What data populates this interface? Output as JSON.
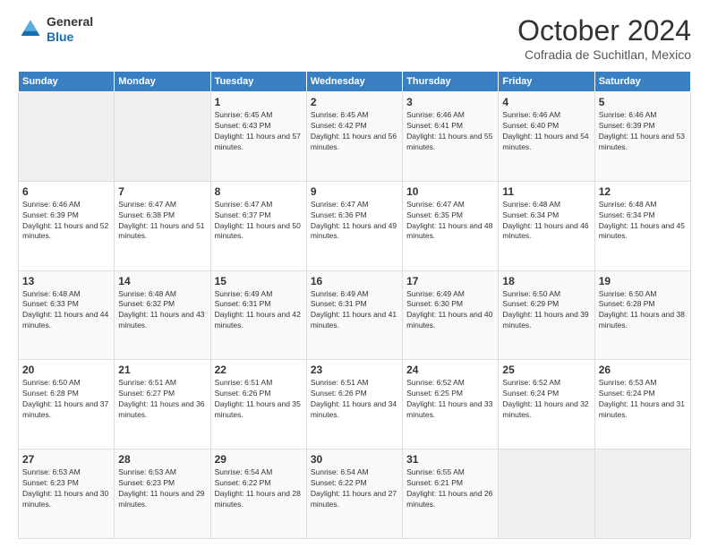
{
  "logo": {
    "general": "General",
    "blue": "Blue"
  },
  "header": {
    "month": "October 2024",
    "location": "Cofradia de Suchitlan, Mexico"
  },
  "weekdays": [
    "Sunday",
    "Monday",
    "Tuesday",
    "Wednesday",
    "Thursday",
    "Friday",
    "Saturday"
  ],
  "weeks": [
    [
      {
        "day": "",
        "sunrise": "",
        "sunset": "",
        "daylight": ""
      },
      {
        "day": "",
        "sunrise": "",
        "sunset": "",
        "daylight": ""
      },
      {
        "day": "1",
        "sunrise": "Sunrise: 6:45 AM",
        "sunset": "Sunset: 6:43 PM",
        "daylight": "Daylight: 11 hours and 57 minutes."
      },
      {
        "day": "2",
        "sunrise": "Sunrise: 6:45 AM",
        "sunset": "Sunset: 6:42 PM",
        "daylight": "Daylight: 11 hours and 56 minutes."
      },
      {
        "day": "3",
        "sunrise": "Sunrise: 6:46 AM",
        "sunset": "Sunset: 6:41 PM",
        "daylight": "Daylight: 11 hours and 55 minutes."
      },
      {
        "day": "4",
        "sunrise": "Sunrise: 6:46 AM",
        "sunset": "Sunset: 6:40 PM",
        "daylight": "Daylight: 11 hours and 54 minutes."
      },
      {
        "day": "5",
        "sunrise": "Sunrise: 6:46 AM",
        "sunset": "Sunset: 6:39 PM",
        "daylight": "Daylight: 11 hours and 53 minutes."
      }
    ],
    [
      {
        "day": "6",
        "sunrise": "Sunrise: 6:46 AM",
        "sunset": "Sunset: 6:39 PM",
        "daylight": "Daylight: 11 hours and 52 minutes."
      },
      {
        "day": "7",
        "sunrise": "Sunrise: 6:47 AM",
        "sunset": "Sunset: 6:38 PM",
        "daylight": "Daylight: 11 hours and 51 minutes."
      },
      {
        "day": "8",
        "sunrise": "Sunrise: 6:47 AM",
        "sunset": "Sunset: 6:37 PM",
        "daylight": "Daylight: 11 hours and 50 minutes."
      },
      {
        "day": "9",
        "sunrise": "Sunrise: 6:47 AM",
        "sunset": "Sunset: 6:36 PM",
        "daylight": "Daylight: 11 hours and 49 minutes."
      },
      {
        "day": "10",
        "sunrise": "Sunrise: 6:47 AM",
        "sunset": "Sunset: 6:35 PM",
        "daylight": "Daylight: 11 hours and 48 minutes."
      },
      {
        "day": "11",
        "sunrise": "Sunrise: 6:48 AM",
        "sunset": "Sunset: 6:34 PM",
        "daylight": "Daylight: 11 hours and 46 minutes."
      },
      {
        "day": "12",
        "sunrise": "Sunrise: 6:48 AM",
        "sunset": "Sunset: 6:34 PM",
        "daylight": "Daylight: 11 hours and 45 minutes."
      }
    ],
    [
      {
        "day": "13",
        "sunrise": "Sunrise: 6:48 AM",
        "sunset": "Sunset: 6:33 PM",
        "daylight": "Daylight: 11 hours and 44 minutes."
      },
      {
        "day": "14",
        "sunrise": "Sunrise: 6:48 AM",
        "sunset": "Sunset: 6:32 PM",
        "daylight": "Daylight: 11 hours and 43 minutes."
      },
      {
        "day": "15",
        "sunrise": "Sunrise: 6:49 AM",
        "sunset": "Sunset: 6:31 PM",
        "daylight": "Daylight: 11 hours and 42 minutes."
      },
      {
        "day": "16",
        "sunrise": "Sunrise: 6:49 AM",
        "sunset": "Sunset: 6:31 PM",
        "daylight": "Daylight: 11 hours and 41 minutes."
      },
      {
        "day": "17",
        "sunrise": "Sunrise: 6:49 AM",
        "sunset": "Sunset: 6:30 PM",
        "daylight": "Daylight: 11 hours and 40 minutes."
      },
      {
        "day": "18",
        "sunrise": "Sunrise: 6:50 AM",
        "sunset": "Sunset: 6:29 PM",
        "daylight": "Daylight: 11 hours and 39 minutes."
      },
      {
        "day": "19",
        "sunrise": "Sunrise: 6:50 AM",
        "sunset": "Sunset: 6:28 PM",
        "daylight": "Daylight: 11 hours and 38 minutes."
      }
    ],
    [
      {
        "day": "20",
        "sunrise": "Sunrise: 6:50 AM",
        "sunset": "Sunset: 6:28 PM",
        "daylight": "Daylight: 11 hours and 37 minutes."
      },
      {
        "day": "21",
        "sunrise": "Sunrise: 6:51 AM",
        "sunset": "Sunset: 6:27 PM",
        "daylight": "Daylight: 11 hours and 36 minutes."
      },
      {
        "day": "22",
        "sunrise": "Sunrise: 6:51 AM",
        "sunset": "Sunset: 6:26 PM",
        "daylight": "Daylight: 11 hours and 35 minutes."
      },
      {
        "day": "23",
        "sunrise": "Sunrise: 6:51 AM",
        "sunset": "Sunset: 6:26 PM",
        "daylight": "Daylight: 11 hours and 34 minutes."
      },
      {
        "day": "24",
        "sunrise": "Sunrise: 6:52 AM",
        "sunset": "Sunset: 6:25 PM",
        "daylight": "Daylight: 11 hours and 33 minutes."
      },
      {
        "day": "25",
        "sunrise": "Sunrise: 6:52 AM",
        "sunset": "Sunset: 6:24 PM",
        "daylight": "Daylight: 11 hours and 32 minutes."
      },
      {
        "day": "26",
        "sunrise": "Sunrise: 6:53 AM",
        "sunset": "Sunset: 6:24 PM",
        "daylight": "Daylight: 11 hours and 31 minutes."
      }
    ],
    [
      {
        "day": "27",
        "sunrise": "Sunrise: 6:53 AM",
        "sunset": "Sunset: 6:23 PM",
        "daylight": "Daylight: 11 hours and 30 minutes."
      },
      {
        "day": "28",
        "sunrise": "Sunrise: 6:53 AM",
        "sunset": "Sunset: 6:23 PM",
        "daylight": "Daylight: 11 hours and 29 minutes."
      },
      {
        "day": "29",
        "sunrise": "Sunrise: 6:54 AM",
        "sunset": "Sunset: 6:22 PM",
        "daylight": "Daylight: 11 hours and 28 minutes."
      },
      {
        "day": "30",
        "sunrise": "Sunrise: 6:54 AM",
        "sunset": "Sunset: 6:22 PM",
        "daylight": "Daylight: 11 hours and 27 minutes."
      },
      {
        "day": "31",
        "sunrise": "Sunrise: 6:55 AM",
        "sunset": "Sunset: 6:21 PM",
        "daylight": "Daylight: 11 hours and 26 minutes."
      },
      {
        "day": "",
        "sunrise": "",
        "sunset": "",
        "daylight": ""
      },
      {
        "day": "",
        "sunrise": "",
        "sunset": "",
        "daylight": ""
      }
    ]
  ]
}
